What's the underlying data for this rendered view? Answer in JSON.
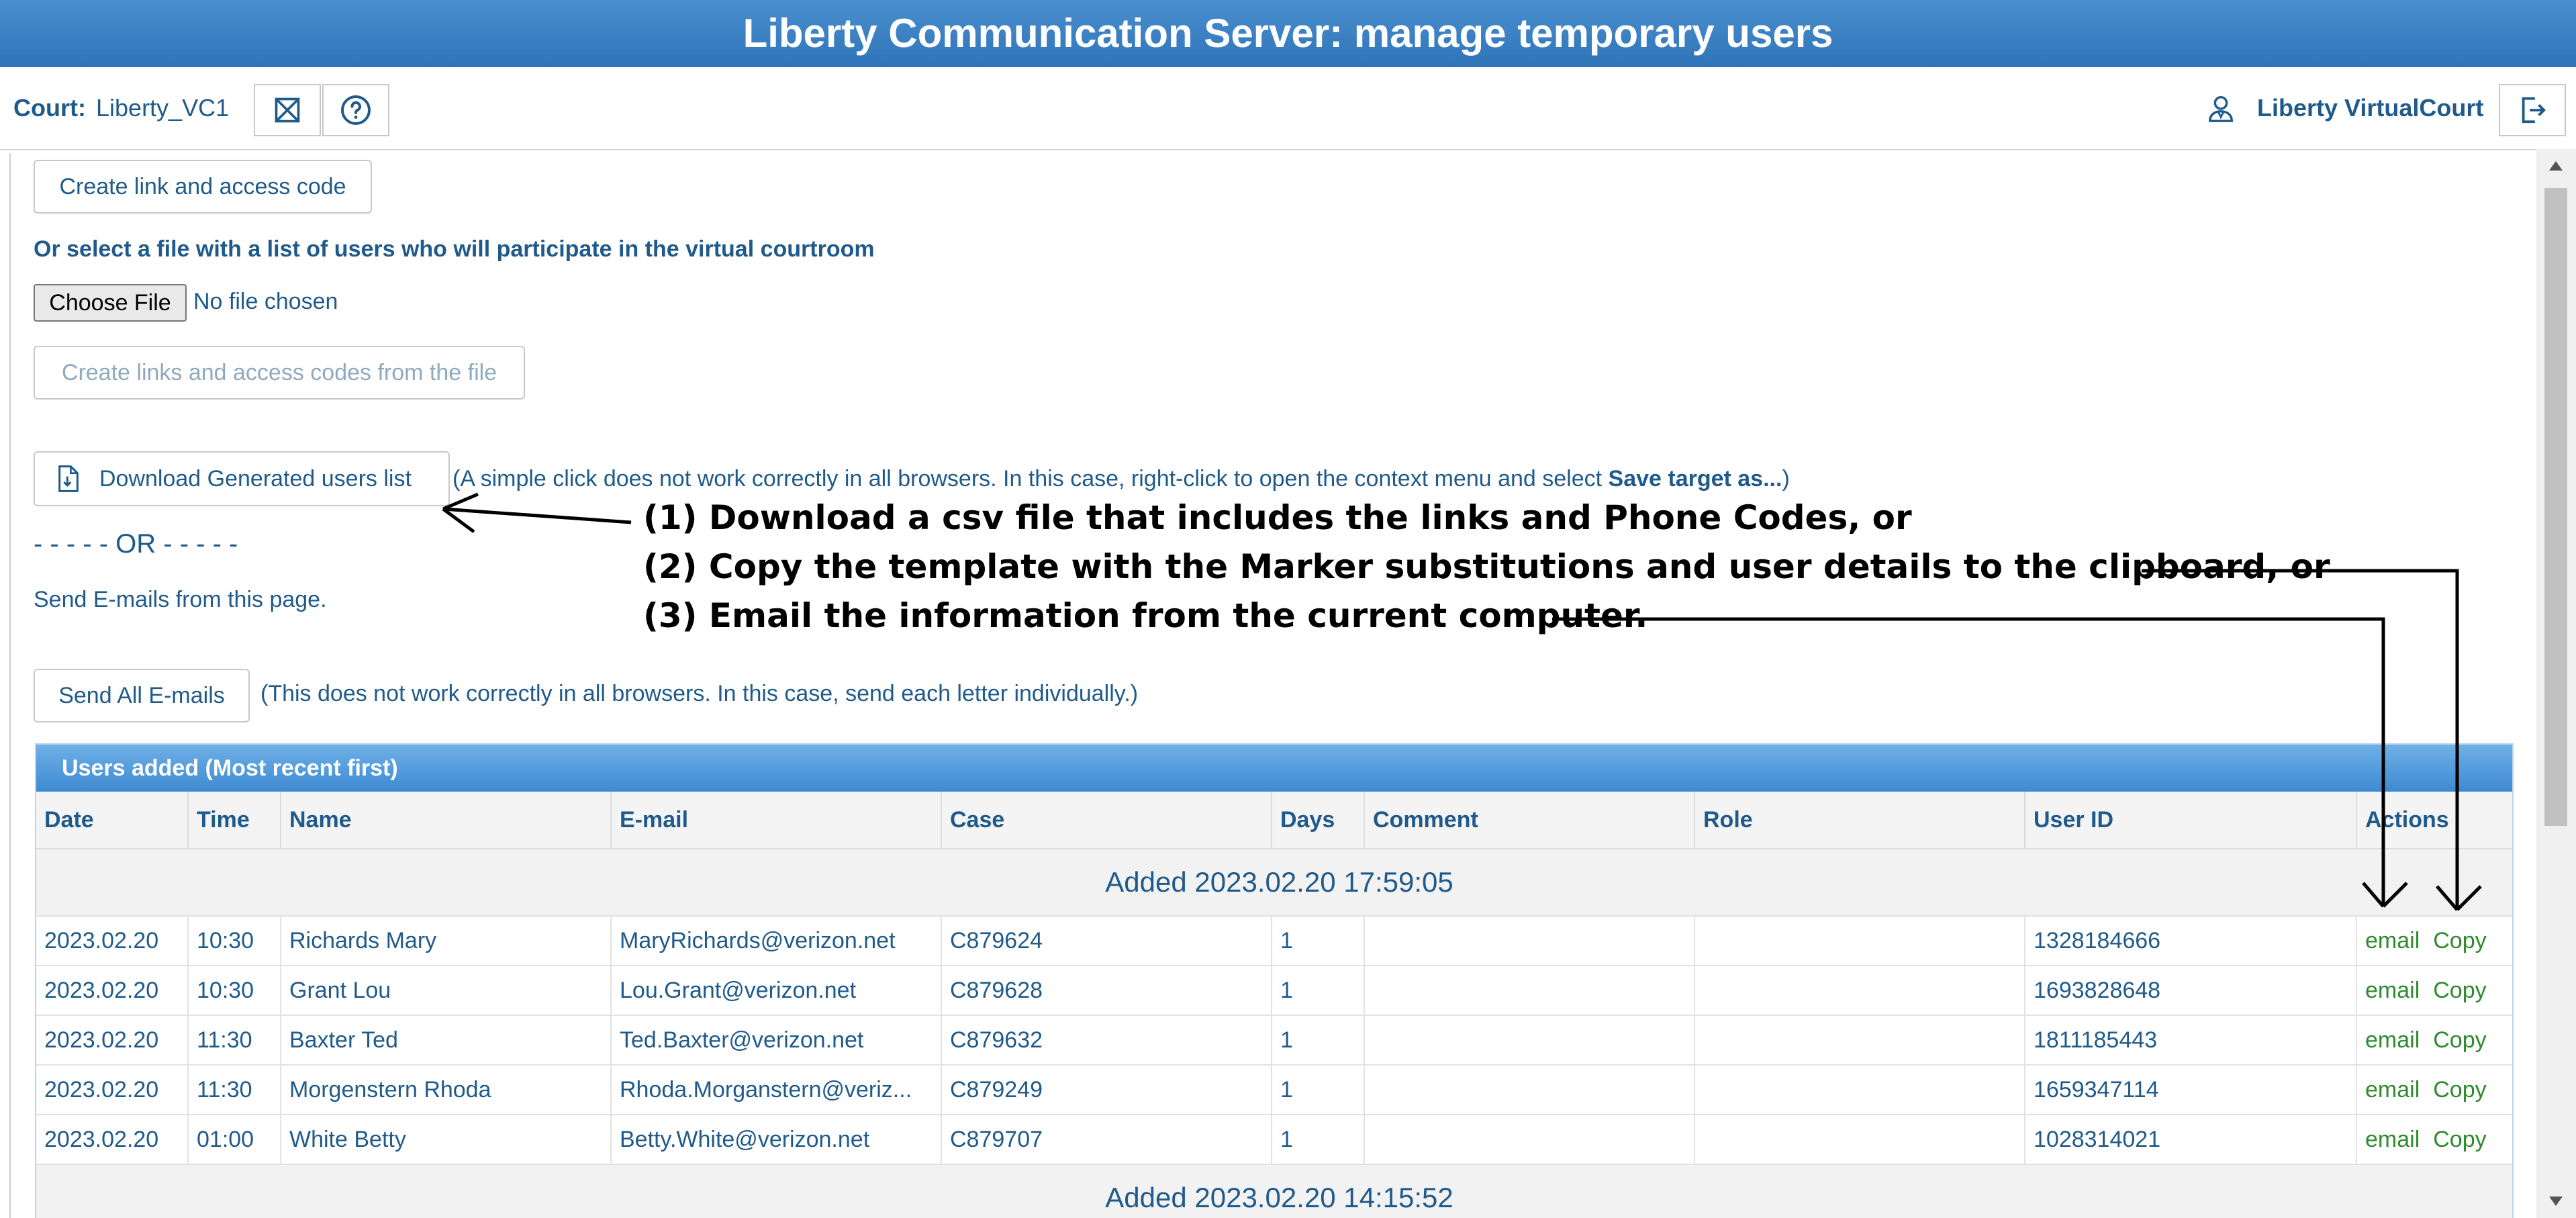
{
  "title": "Liberty Communication Server: manage temporary users",
  "header": {
    "court_label": "Court:",
    "court_name": "Liberty_VC1",
    "user_name": "Liberty VirtualCourt"
  },
  "main": {
    "create_link_button": "Create link and access code",
    "select_file_prompt": "Or select a file with a list of users who will participate in the virtual courtroom",
    "choose_file_button": "Choose File",
    "no_file_text": "No file chosen",
    "create_from_file_button": "Create links and access codes from the file",
    "download_button": "Download Generated users list",
    "download_hint_prefix": "(A simple click does not work correctly in all browsers. In this case, right-click to open the context menu and select ",
    "download_hint_bold": "Save target as...",
    "download_hint_suffix": ")",
    "or_divider": "- - - - - OR - - - - -",
    "send_emails_text": "Send E-mails from this page.",
    "send_all_button": "Send All E-mails",
    "send_all_hint": "(This does not work correctly in all browsers. In this case, send each letter individually.)"
  },
  "annotations": [
    "(1) Download a csv file that includes the links and Phone Codes, or",
    "(2) Copy the template with the Marker substitutions and user details to the clipboard, or",
    "(3) Email the information from the current computer."
  ],
  "users_panel": {
    "title": "Users added (Most recent first)",
    "columns": [
      "Date",
      "Time",
      "Name",
      "E-mail",
      "Case",
      "Days",
      "Comment",
      "Role",
      "User ID",
      "Actions"
    ],
    "groups": [
      {
        "label": "Added 2023.02.20 17:59:05",
        "rows": [
          {
            "date": "2023.02.20",
            "time": "10:30",
            "name": "Richards Mary",
            "email": "MaryRichards@verizon.net",
            "case": "C879624",
            "days": "1",
            "comment": "",
            "role": "",
            "user_id": "1328184666"
          },
          {
            "date": "2023.02.20",
            "time": "10:30",
            "name": "Grant Lou",
            "email": "Lou.Grant@verizon.net",
            "case": "C879628",
            "days": "1",
            "comment": "",
            "role": "",
            "user_id": "1693828648"
          },
          {
            "date": "2023.02.20",
            "time": "11:30",
            "name": "Baxter Ted",
            "email": "Ted.Baxter@verizon.net",
            "case": "C879632",
            "days": "1",
            "comment": "",
            "role": "",
            "user_id": "1811185443"
          },
          {
            "date": "2023.02.20",
            "time": "11:30",
            "name": "Morgenstern Rhoda",
            "email": "Rhoda.Morganstern@veriz...",
            "case": "C879249",
            "days": "1",
            "comment": "",
            "role": "",
            "user_id": "1659347114"
          },
          {
            "date": "2023.02.20",
            "time": "01:00",
            "name": "White Betty",
            "email": "Betty.White@verizon.net",
            "case": "C879707",
            "days": "1",
            "comment": "",
            "role": "",
            "user_id": "1028314021"
          }
        ]
      },
      {
        "label": "Added 2023.02.20 14:15:52",
        "rows": []
      }
    ],
    "action_email": "email",
    "action_copy": "Copy"
  },
  "icons": {
    "email_template": "envelope-x-icon",
    "help": "question-circle-icon",
    "user": "user-icon",
    "logout": "logout-icon",
    "download": "file-download-icon"
  },
  "colors": {
    "title_bar": "#2f74b8",
    "text": "#1f5a8a",
    "action_green": "#2e8b2e",
    "panel_header": "#3d8ad0"
  }
}
